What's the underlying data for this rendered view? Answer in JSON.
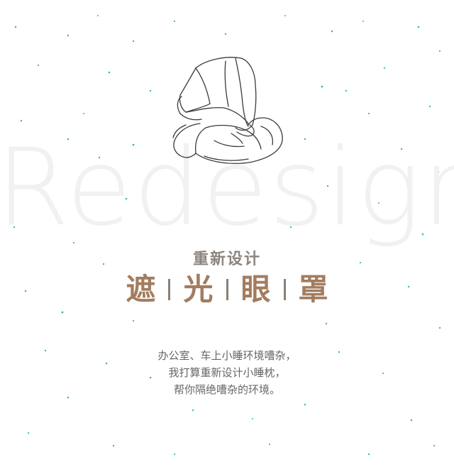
{
  "background_word": "Redesign",
  "subtitle": "重新设计",
  "title_chars": [
    "遮",
    "光",
    "眼",
    "罩"
  ],
  "description_lines": [
    "办公室、车上小睡环境嘈杂，",
    "我打算重新设计小睡枕，",
    "帮你隔绝嘈杂的环境。"
  ],
  "colors": {
    "title": "#a37c5f",
    "subtitle": "#8c857e",
    "description": "#666666",
    "dots": "#3fb7b1",
    "background_word": "#f1f1f1"
  },
  "icons": [
    "pillow-sketch-icon"
  ]
}
